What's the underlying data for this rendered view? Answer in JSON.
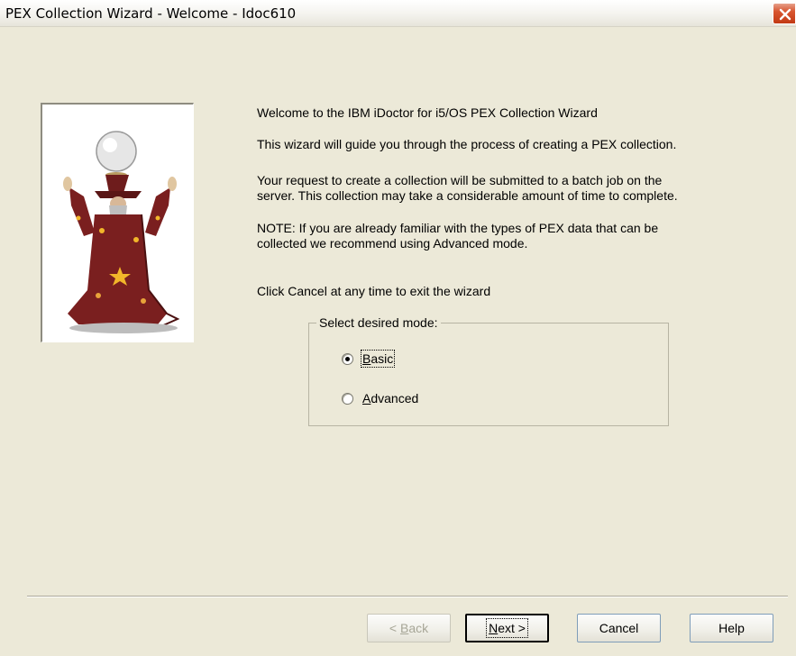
{
  "window": {
    "title": "PEX Collection Wizard - Welcome - Idoc610"
  },
  "content": {
    "heading": "Welcome to the IBM iDoctor for i5/OS PEX Collection Wizard",
    "intro": "This wizard will guide you through the process of creating a PEX collection.",
    "batch_line1": "Your request to create a collection will be submitted to a batch job on the",
    "batch_line2": "server.  This collection may take a considerable amount of time to complete.",
    "note_line1": "NOTE:  If you are already familiar with the types of PEX data that can be",
    "note_line2": "collected we recommend using Advanced mode.",
    "cancel_hint": "Click Cancel at any time to exit the wizard"
  },
  "mode_group": {
    "label": "Select desired mode:",
    "options": [
      {
        "access_key": "B",
        "rest": "asic",
        "selected": true
      },
      {
        "access_key": "A",
        "rest": "dvanced",
        "selected": false
      }
    ]
  },
  "buttons": {
    "back": {
      "prefix": "< ",
      "access_key": "B",
      "rest": "ack",
      "enabled": false
    },
    "next": {
      "access_key": "N",
      "rest": "ext >",
      "default": true
    },
    "cancel": "Cancel",
    "help": "Help"
  },
  "colors": {
    "window_bg": "#ece9d8",
    "close_button": "#d8552f",
    "wizard_robe": "#7a1f1f",
    "wizard_stars": "#f2b62a"
  },
  "icons": {
    "close": "close-x-icon",
    "illustration": "wizard-illustration"
  }
}
